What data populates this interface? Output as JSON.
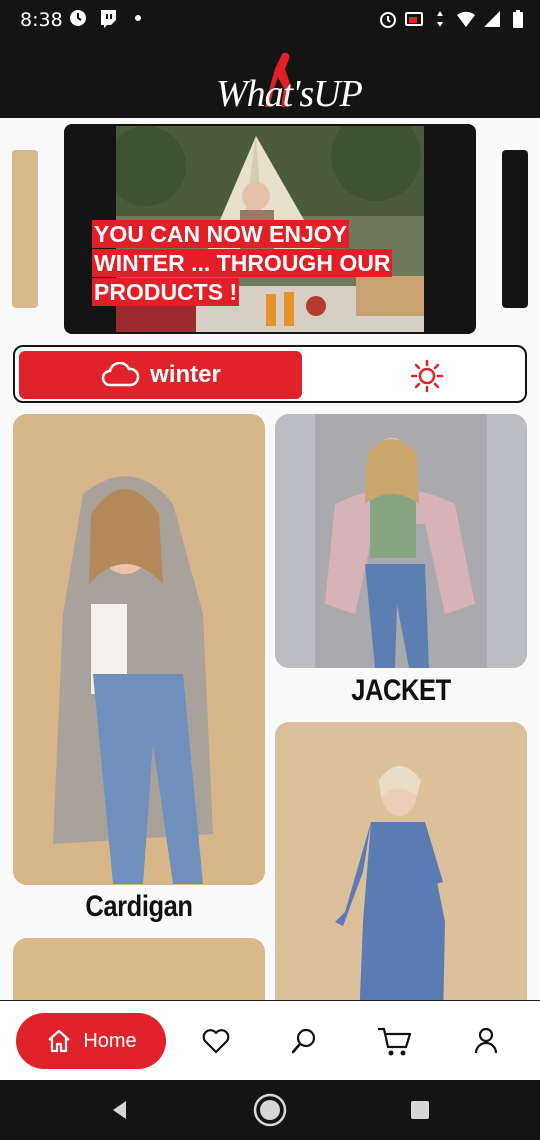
{
  "status_bar": {
    "time": "8:38",
    "left_icons": [
      "clock-icon",
      "twitch-icon",
      "dot-icon"
    ],
    "right_icons": [
      "alarm-icon",
      "cast-icon",
      "data-arrows-icon",
      "wifi-icon",
      "signal-icon",
      "battery-icon"
    ]
  },
  "header": {
    "logo_text": "What'sUP"
  },
  "banner": {
    "lines": [
      "YOU CAN NOW ENJOY",
      "WINTER ... THROUGH OUR",
      "PRODUCTS !"
    ]
  },
  "season_toggle": {
    "active_label": "winter",
    "active_icon": "cloud-icon",
    "inactive_icon": "sun-icon"
  },
  "categories": [
    {
      "label": "Cardigan"
    },
    {
      "label": "JACKET"
    },
    {
      "label": ""
    },
    {
      "label": ""
    }
  ],
  "bottom_nav": {
    "home_label": "Home",
    "items": [
      "home-icon",
      "heart-icon",
      "search-icon",
      "cart-icon",
      "profile-icon"
    ]
  },
  "colors": {
    "accent": "#e0232a",
    "dark": "#141414",
    "background": "#fafafa"
  }
}
